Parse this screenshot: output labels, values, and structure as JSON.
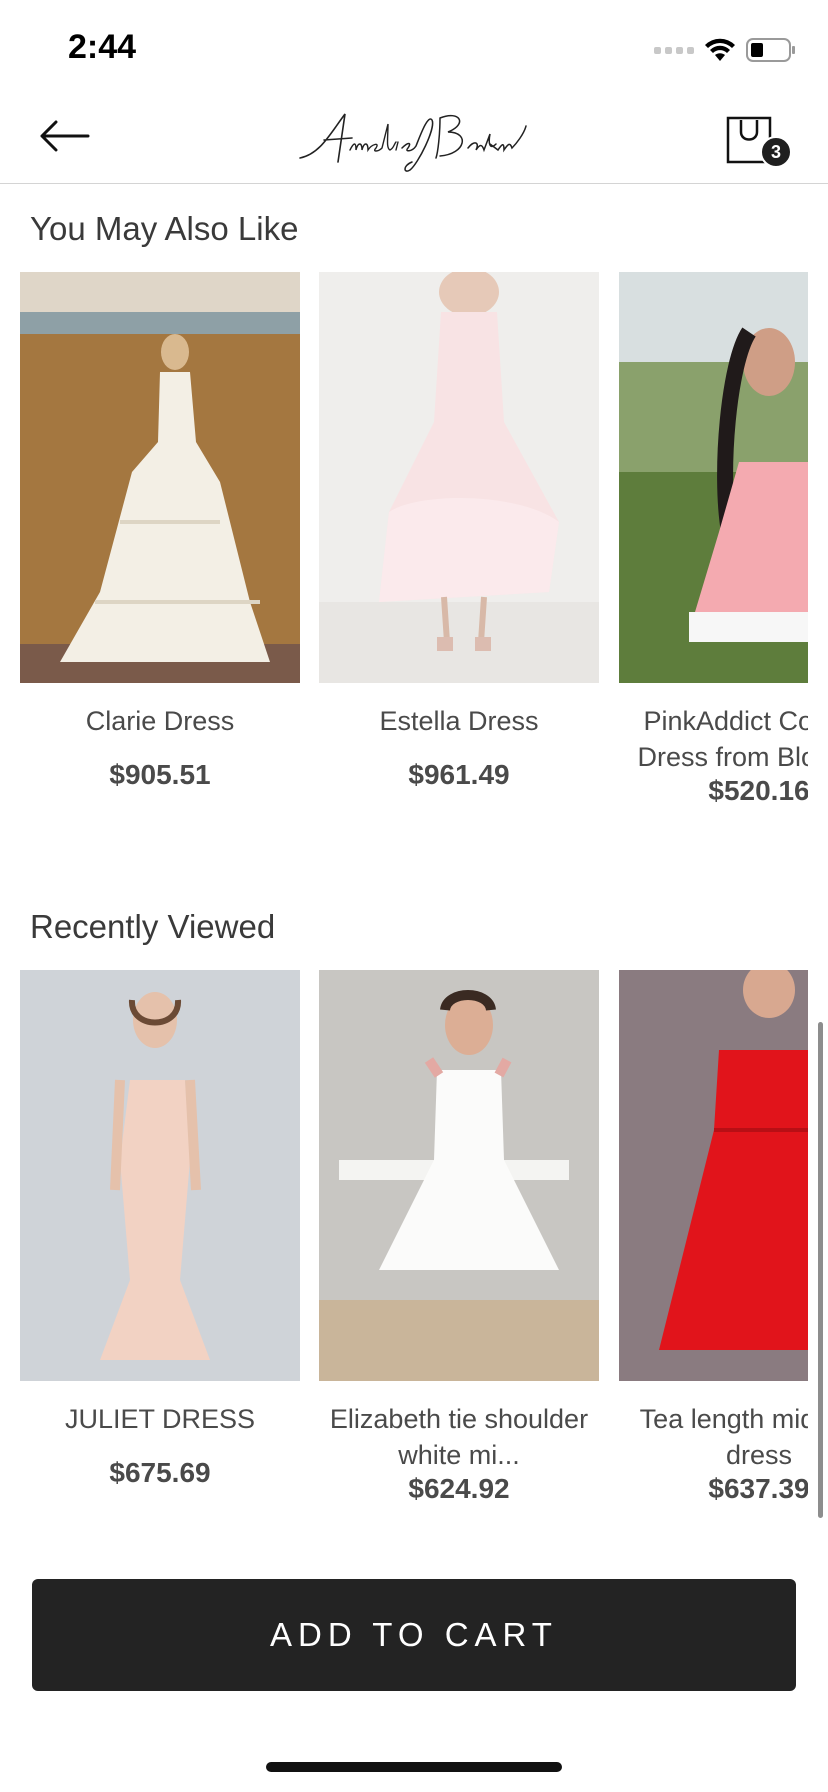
{
  "status_bar": {
    "time": "2:44"
  },
  "header": {
    "logo_text": "AmelieBaku",
    "cart_count": "3"
  },
  "you_may_also_like": {
    "title": "You May Also Like",
    "items": [
      {
        "name": "Clarie Dress",
        "price": "$905.51"
      },
      {
        "name": "Estella Dress",
        "price": "$961.49"
      },
      {
        "name": "PinkAddict Cocktail Dress from Blossom",
        "price": "$520.16"
      }
    ]
  },
  "recently_viewed": {
    "title": "Recently Viewed",
    "items": [
      {
        "name": "JULIET DRESS",
        "price": "$675.69"
      },
      {
        "name": "Elizabeth tie shoulder white mi...",
        "price": "$624.92"
      },
      {
        "name": "Tea length midi Ren dress",
        "price": "$637.39"
      }
    ]
  },
  "cta": {
    "label": "ADD TO CART"
  },
  "colors": {
    "button_bg": "#232323",
    "text": "#4a4a4a",
    "badge": "#1f1f1f"
  }
}
